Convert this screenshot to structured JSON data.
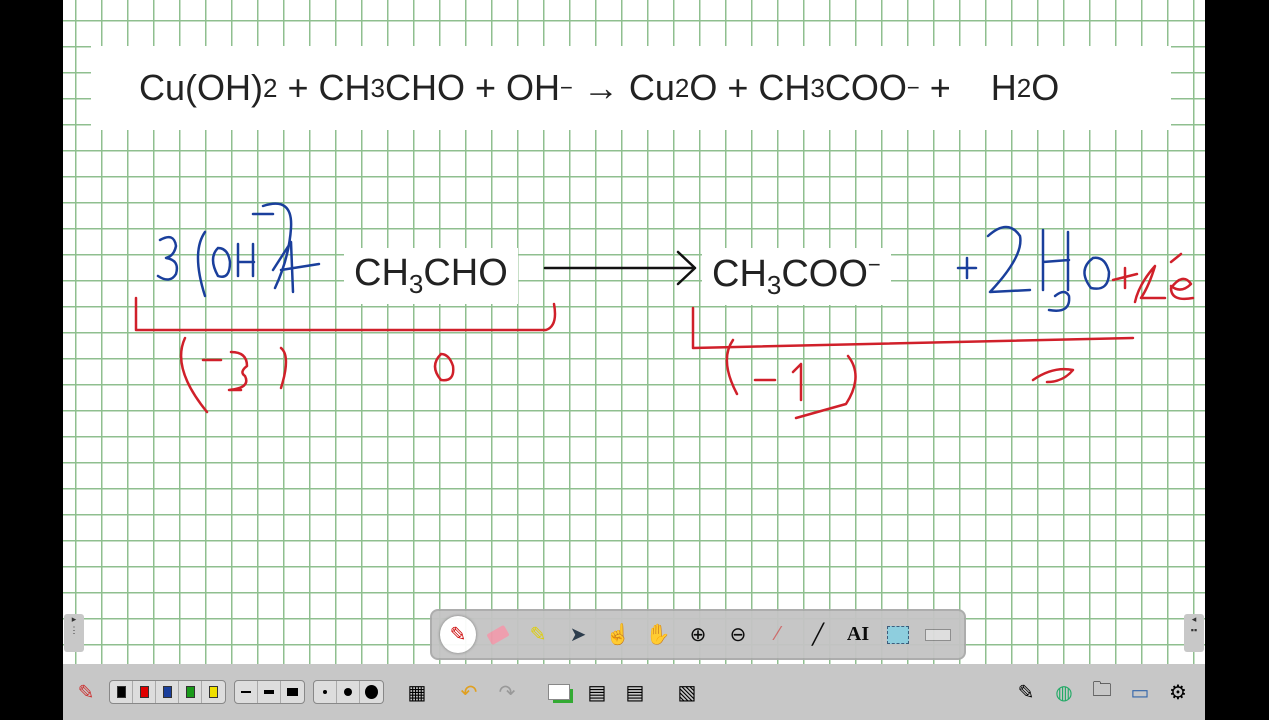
{
  "equation": {
    "lhs1": "Cu(OH)",
    "lhs1_sub": "2",
    "plus1": " + CH",
    "ald_sub": "3",
    "ald_rest": "CHO + OH",
    "oh_sup": "−",
    "arrow": " → Cu",
    "cu_sub": "2",
    "o_plus": "O + CH",
    "ac_sub": "3",
    "ac_rest": "COO",
    "ac_sup": "−",
    "plus_end": " +    H",
    "w_sub": "2",
    "w_end": "O"
  },
  "work": {
    "left_h": "CH",
    "left_sub": "3",
    "left_rest": "CHO",
    "right_h": "CH",
    "right_sub": "3",
    "right_rest": "COO",
    "right_sup": "−"
  },
  "colors": {
    "grid": "#8fbf8f",
    "ink_blue": "#1a3f9c",
    "ink_red": "#d0202a"
  },
  "toolbar": {
    "tools": [
      "pen",
      "eraser",
      "highlighter",
      "select",
      "pointer",
      "pan",
      "zoom-in",
      "zoom-out",
      "laser",
      "line",
      "text",
      "screen-capture",
      "keyboard"
    ],
    "active": "pen"
  },
  "bottom": {
    "colors": [
      "#000000",
      "#e00000",
      "#1a3f9c",
      "#1a9a1a",
      "#f0e000"
    ]
  }
}
